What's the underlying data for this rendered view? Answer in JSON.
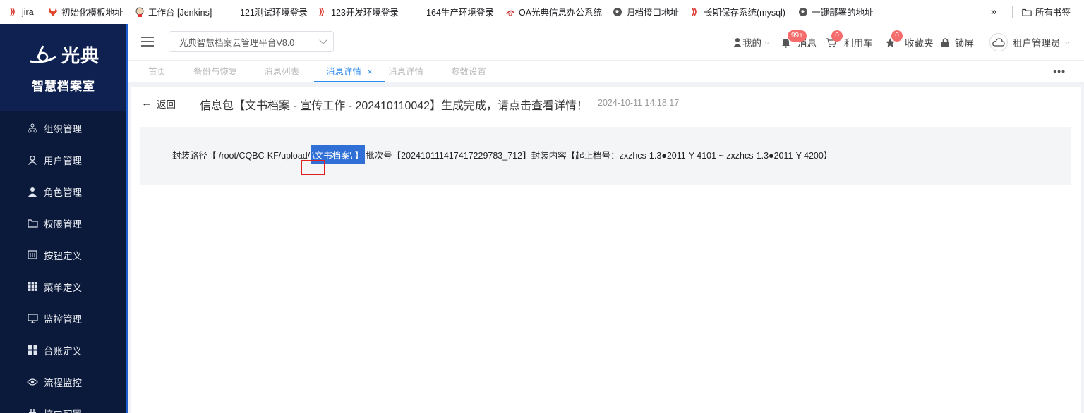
{
  "bookmarks": [
    {
      "label": "jira",
      "icon": "jira-icon"
    },
    {
      "label": "初始化模板地址",
      "icon": "gitlab-icon"
    },
    {
      "label": "工作台 [Jenkins]",
      "icon": "jenkins-icon"
    },
    {
      "label": "121测试环境登录",
      "icon": "none"
    },
    {
      "label": "123开发环境登录",
      "icon": "jira-icon"
    },
    {
      "label": "164生产环境登录",
      "icon": "none"
    },
    {
      "label": "OA光典信息办公系统",
      "icon": "logo-icon"
    },
    {
      "label": "归档接口地址",
      "icon": "globe-icon"
    },
    {
      "label": "长期保存系统(mysql)",
      "icon": "jira-icon"
    },
    {
      "label": "一键部署的地址",
      "icon": "globe-icon"
    }
  ],
  "bookmarks_more": "»",
  "bookmarks_all": "所有书签",
  "sidebar": {
    "logo_text": "光典",
    "subtitle": "智慧档案室",
    "items": [
      {
        "label": "组织管理",
        "icon": "org-tree-icon"
      },
      {
        "label": "用户管理",
        "icon": "user-icon"
      },
      {
        "label": "角色管理",
        "icon": "role-icon"
      },
      {
        "label": "权限管理",
        "icon": "folder-icon"
      },
      {
        "label": "按钮定义",
        "icon": "button-icon"
      },
      {
        "label": "菜单定义",
        "icon": "grid-icon"
      },
      {
        "label": "监控管理",
        "icon": "monitor-icon"
      },
      {
        "label": "台账定义",
        "icon": "apps-icon"
      },
      {
        "label": "流程监控",
        "icon": "eye-icon"
      },
      {
        "label": "接口配置",
        "icon": "plug-icon"
      }
    ]
  },
  "header": {
    "platform": "光典智慧档案云管理平台V8.0",
    "mine": "我的",
    "messages": "消息",
    "messages_badge": "99+",
    "cart": "利用车",
    "cart_badge": "0",
    "favorites": "收藏夹",
    "favorites_badge": "0",
    "lock": "锁屏",
    "user": "租户管理员"
  },
  "tabs": [
    {
      "label": "首页",
      "active": false
    },
    {
      "label": "备份与恢复",
      "active": false
    },
    {
      "label": "消息列表",
      "active": false
    },
    {
      "label": "消息详情",
      "active": true,
      "close": "×"
    },
    {
      "label": "消息详情",
      "active": false
    },
    {
      "label": "参数设置",
      "active": false
    }
  ],
  "tabs_more": "•••",
  "detail": {
    "back_label": "返回",
    "title": "信息包【文书档案 - 宣传工作 - 202410110042】生成完成，请点击查看详情！",
    "time": "2024-10-11 14:18:17",
    "path_prefix": "封装路径【 /root/CQBC-KF/upload/",
    "path_highlight": "\\文书档案\\ 】",
    "batch_text": "批次号【20241011141741722978​3_712】封装内容【起止档号：zxzhcs-1.3●2011-Y-4101 ~ zxzhcs-1.3●2011-Y-4200】"
  },
  "colors": {
    "sidebar": "#0b1a3a",
    "accent": "#2d8cf0",
    "badge": "#f56c6c",
    "highlight": "#2f6fd6"
  }
}
